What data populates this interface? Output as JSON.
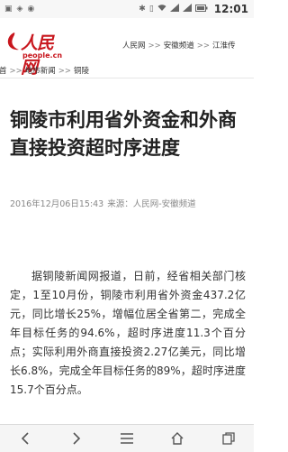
{
  "status_bar": {
    "time": "12:01"
  },
  "site": {
    "logo_text": "人民网",
    "logo_subtext": "people.cn"
  },
  "breadcrumb": [
    "人民网",
    "安徽频道",
    "江淮传"
  ],
  "subnav": {
    "lead": "首",
    "items": [
      "地市新闻",
      "铜陵"
    ]
  },
  "article": {
    "title": "铜陵市利用省外资金和外商直接投资超时序进度",
    "date": "2016年12月06日15:43",
    "source": "来源：人民网-安徽频道",
    "body": "据铜陵新闻网报道，日前，经省相关部门核定，1至10月份，铜陵市利用省外资金437.2亿元，同比增长25%，增幅位居全省第二，完成全年目标任务的94.6%，超时序进度11.3个百分点；实际利用外商直接投资2.27亿美元，同比增长6.8%，完成全年目标任务的89%，超时序进度15.7个百分点。"
  },
  "colors": {
    "brand": "#c8161d"
  }
}
